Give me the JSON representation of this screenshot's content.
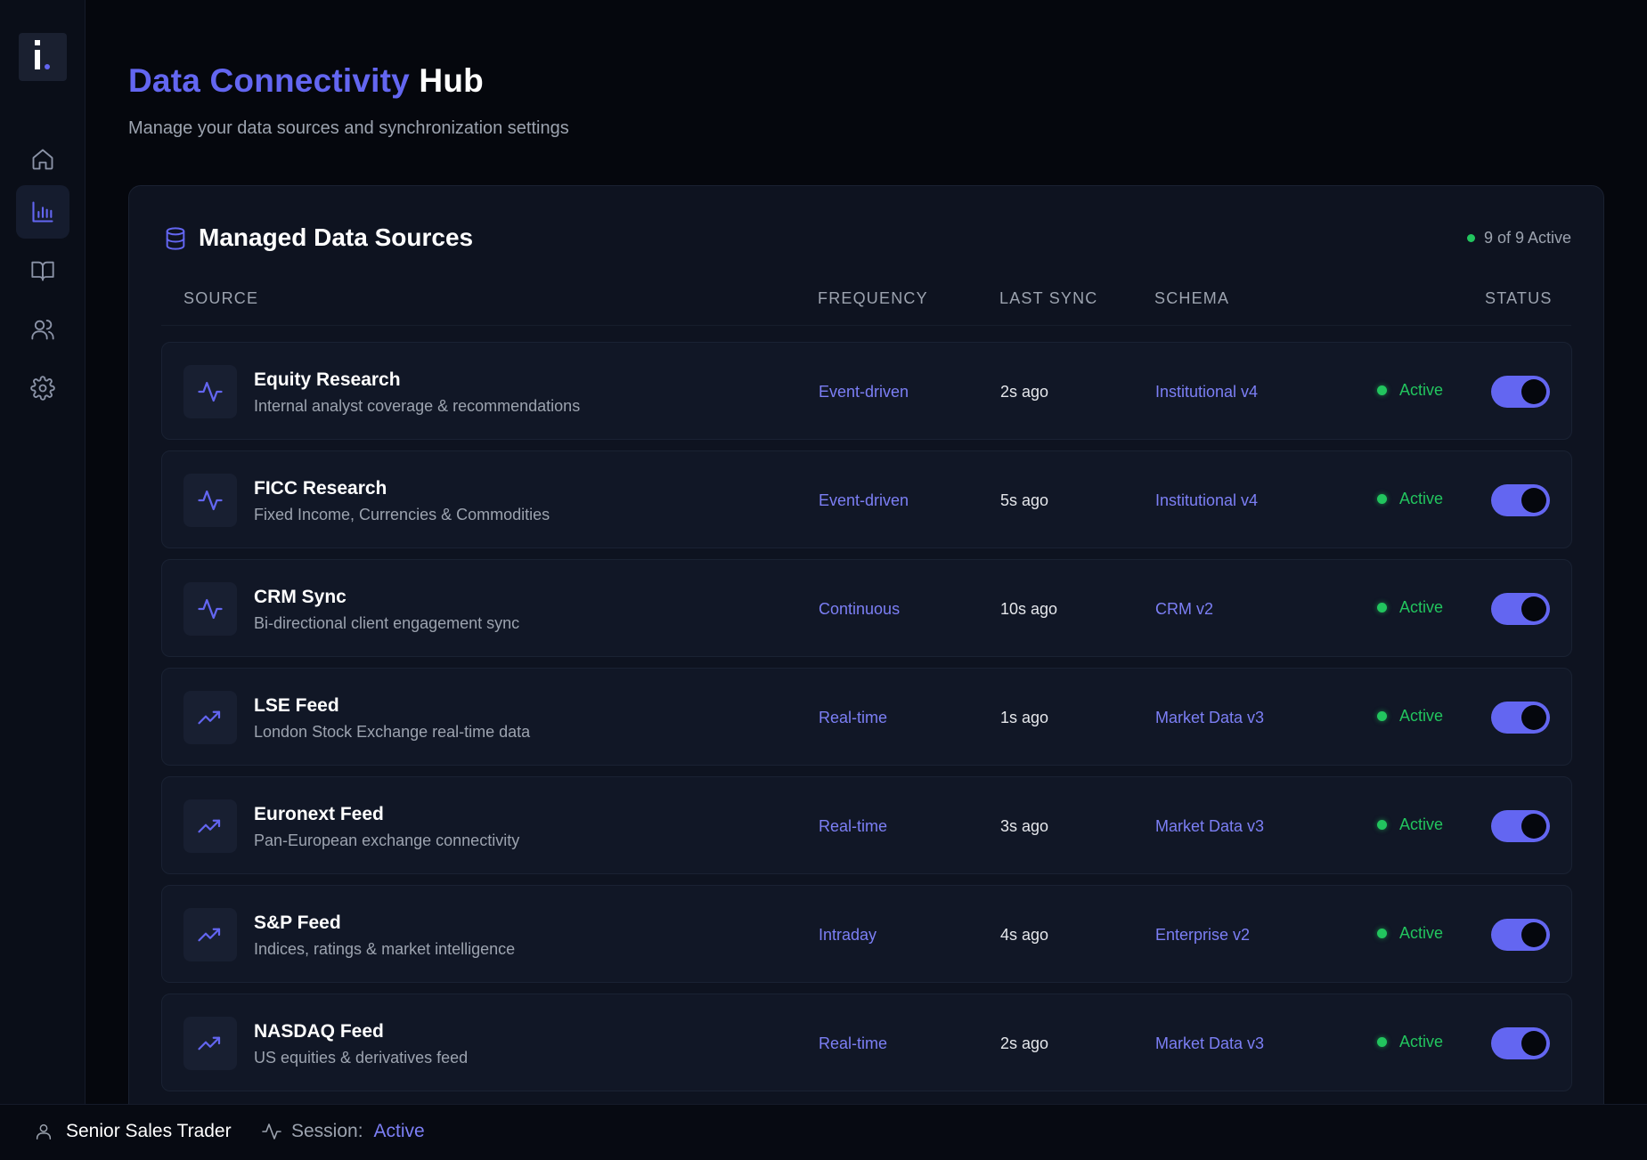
{
  "header": {
    "title_accent": "Data Connectivity",
    "title_rest": "Hub",
    "subtitle": "Manage your data sources and synchronization settings"
  },
  "sidebar": {
    "items": [
      {
        "icon": "home-icon",
        "active": false
      },
      {
        "icon": "bar-chart-icon",
        "active": true
      },
      {
        "icon": "book-icon",
        "active": false
      },
      {
        "icon": "users-icon",
        "active": false
      },
      {
        "icon": "gear-icon",
        "active": false
      }
    ]
  },
  "card": {
    "title": "Managed Data Sources",
    "active_count": "9 of 9 Active",
    "columns": {
      "source": "SOURCE",
      "frequency": "FREQUENCY",
      "last_sync": "LAST SYNC",
      "schema": "SCHEMA",
      "status": "STATUS"
    },
    "rows": [
      {
        "icon": "activity-icon",
        "name": "Equity Research",
        "desc": "Internal analyst coverage & recommendations",
        "frequency": "Event-driven",
        "last_sync": "2s ago",
        "schema": "Institutional v4",
        "status": "Active",
        "enabled": true
      },
      {
        "icon": "activity-icon",
        "name": "FICC Research",
        "desc": "Fixed Income, Currencies & Commodities",
        "frequency": "Event-driven",
        "last_sync": "5s ago",
        "schema": "Institutional v4",
        "status": "Active",
        "enabled": true
      },
      {
        "icon": "activity-icon",
        "name": "CRM Sync",
        "desc": "Bi-directional client engagement sync",
        "frequency": "Continuous",
        "last_sync": "10s ago",
        "schema": "CRM v2",
        "status": "Active",
        "enabled": true
      },
      {
        "icon": "trending-up-icon",
        "name": "LSE Feed",
        "desc": "London Stock Exchange real-time data",
        "frequency": "Real-time",
        "last_sync": "1s ago",
        "schema": "Market Data v3",
        "status": "Active",
        "enabled": true
      },
      {
        "icon": "trending-up-icon",
        "name": "Euronext Feed",
        "desc": "Pan-European exchange connectivity",
        "frequency": "Real-time",
        "last_sync": "3s ago",
        "schema": "Market Data v3",
        "status": "Active",
        "enabled": true
      },
      {
        "icon": "trending-up-icon",
        "name": "S&P Feed",
        "desc": "Indices, ratings & market intelligence",
        "frequency": "Intraday",
        "last_sync": "4s ago",
        "schema": "Enterprise v2",
        "status": "Active",
        "enabled": true
      },
      {
        "icon": "trending-up-icon",
        "name": "NASDAQ Feed",
        "desc": "US equities & derivatives feed",
        "frequency": "Real-time",
        "last_sync": "2s ago",
        "schema": "Market Data v3",
        "status": "Active",
        "enabled": true
      }
    ]
  },
  "footer": {
    "user_role": "Senior Sales Trader",
    "session_label": "Session:",
    "session_value": "Active"
  },
  "colors": {
    "accent": "#6366f1",
    "success": "#22c55e",
    "background": "#05070d"
  }
}
